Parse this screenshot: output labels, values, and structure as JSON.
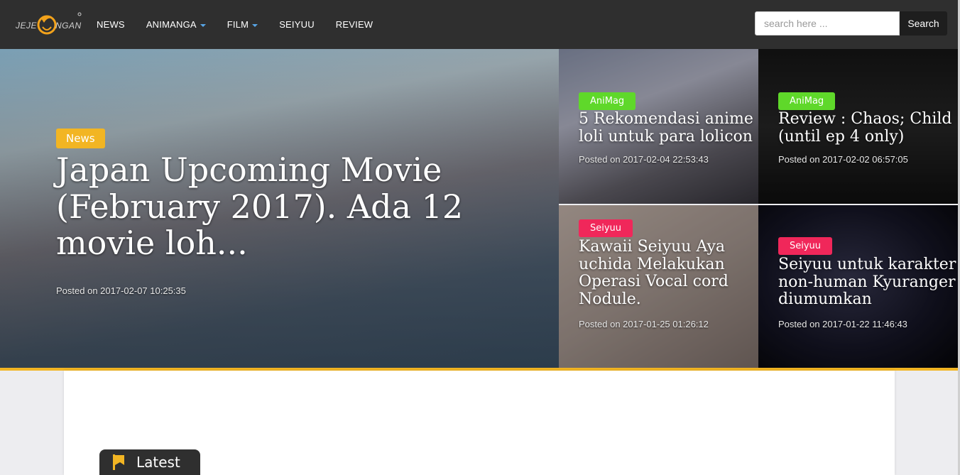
{
  "brand": {
    "logo_text": "JEJEPANGAN",
    "logo_icon": "orange-swirl-logo-icon",
    "colors": {
      "navbar": "#2f2f2f",
      "accent": "#f2b523",
      "animag": "#5fd82a",
      "seiyuu": "#f0275a",
      "caret": "#58a6e8"
    }
  },
  "nav": {
    "items": [
      {
        "label": "NEWS",
        "dropdown": false
      },
      {
        "label": "ANIMANGA",
        "dropdown": true
      },
      {
        "label": "FILM",
        "dropdown": true
      },
      {
        "label": "SEIYUU",
        "dropdown": false
      },
      {
        "label": "REVIEW",
        "dropdown": false
      }
    ],
    "caret_icon": "caret-down-icon"
  },
  "search": {
    "placeholder": "search here ...",
    "button_label": "Search"
  },
  "featured": {
    "main": {
      "tag": "News",
      "title": "Japan Upcoming Movie (February 2017). Ada 12 movie loh...",
      "date": "Posted on 2017-02-07 10:25:35"
    },
    "tiles": [
      {
        "tag": "AniMag",
        "title": "5 Rekomendasi anime loli untuk para lolicon",
        "date": "Posted on 2017-02-04 22:53:43"
      },
      {
        "tag": "AniMag",
        "title": "Review : Chaos; Child (until ep 4 only)",
        "date": "Posted on 2017-02-02 06:57:05"
      },
      {
        "tag": "Seiyuu",
        "title": "Kawaii Seiyuu Aya uchida Melakukan Operasi Vocal cord Nodule.",
        "date": "Posted on 2017-01-25 01:26:12"
      },
      {
        "tag": "Seiyuu",
        "title": "Seiyuu untuk karakter non-human Kyuranger diumumkan",
        "date": "Posted on 2017-01-22 11:46:43"
      }
    ]
  },
  "section": {
    "latest_label": "Latest",
    "latest_icon": "bookmark-icon"
  }
}
